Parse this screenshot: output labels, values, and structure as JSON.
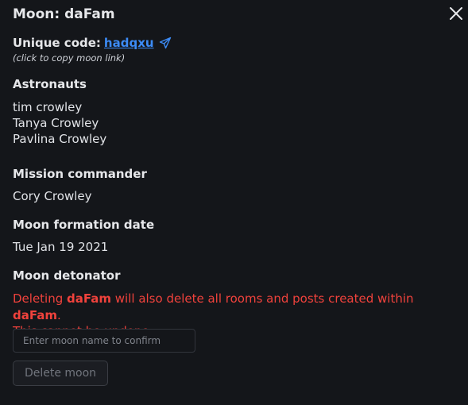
{
  "header": {
    "title": "Moon: daFam"
  },
  "code": {
    "label": "Unique code:",
    "value": "hadqxu",
    "hint": "(click to copy moon link)",
    "link_color": "#3c8bf5"
  },
  "astronauts": {
    "heading": "Astronauts",
    "members": [
      "tim crowley",
      "Tanya Crowley",
      "Pavlina Crowley"
    ]
  },
  "commander": {
    "heading": "Mission commander",
    "name": "Cory Crowley"
  },
  "formation": {
    "heading": "Moon formation date",
    "date": "Tue Jan 19 2021"
  },
  "detonator": {
    "heading": "Moon detonator",
    "warning_prefix": "Deleting ",
    "moon_name": "daFam",
    "warning_middle": " will also delete all rooms and posts created within ",
    "moon_name_2": "daFam",
    "warning_suffix": ".",
    "warning_line2": "This cannot be undone.",
    "input_placeholder": "Enter moon name to confirm",
    "input_value": "",
    "delete_label": "Delete moon",
    "warning_color": "#f0423c"
  },
  "icons": {
    "close": "close-icon",
    "copy": "send-icon"
  }
}
